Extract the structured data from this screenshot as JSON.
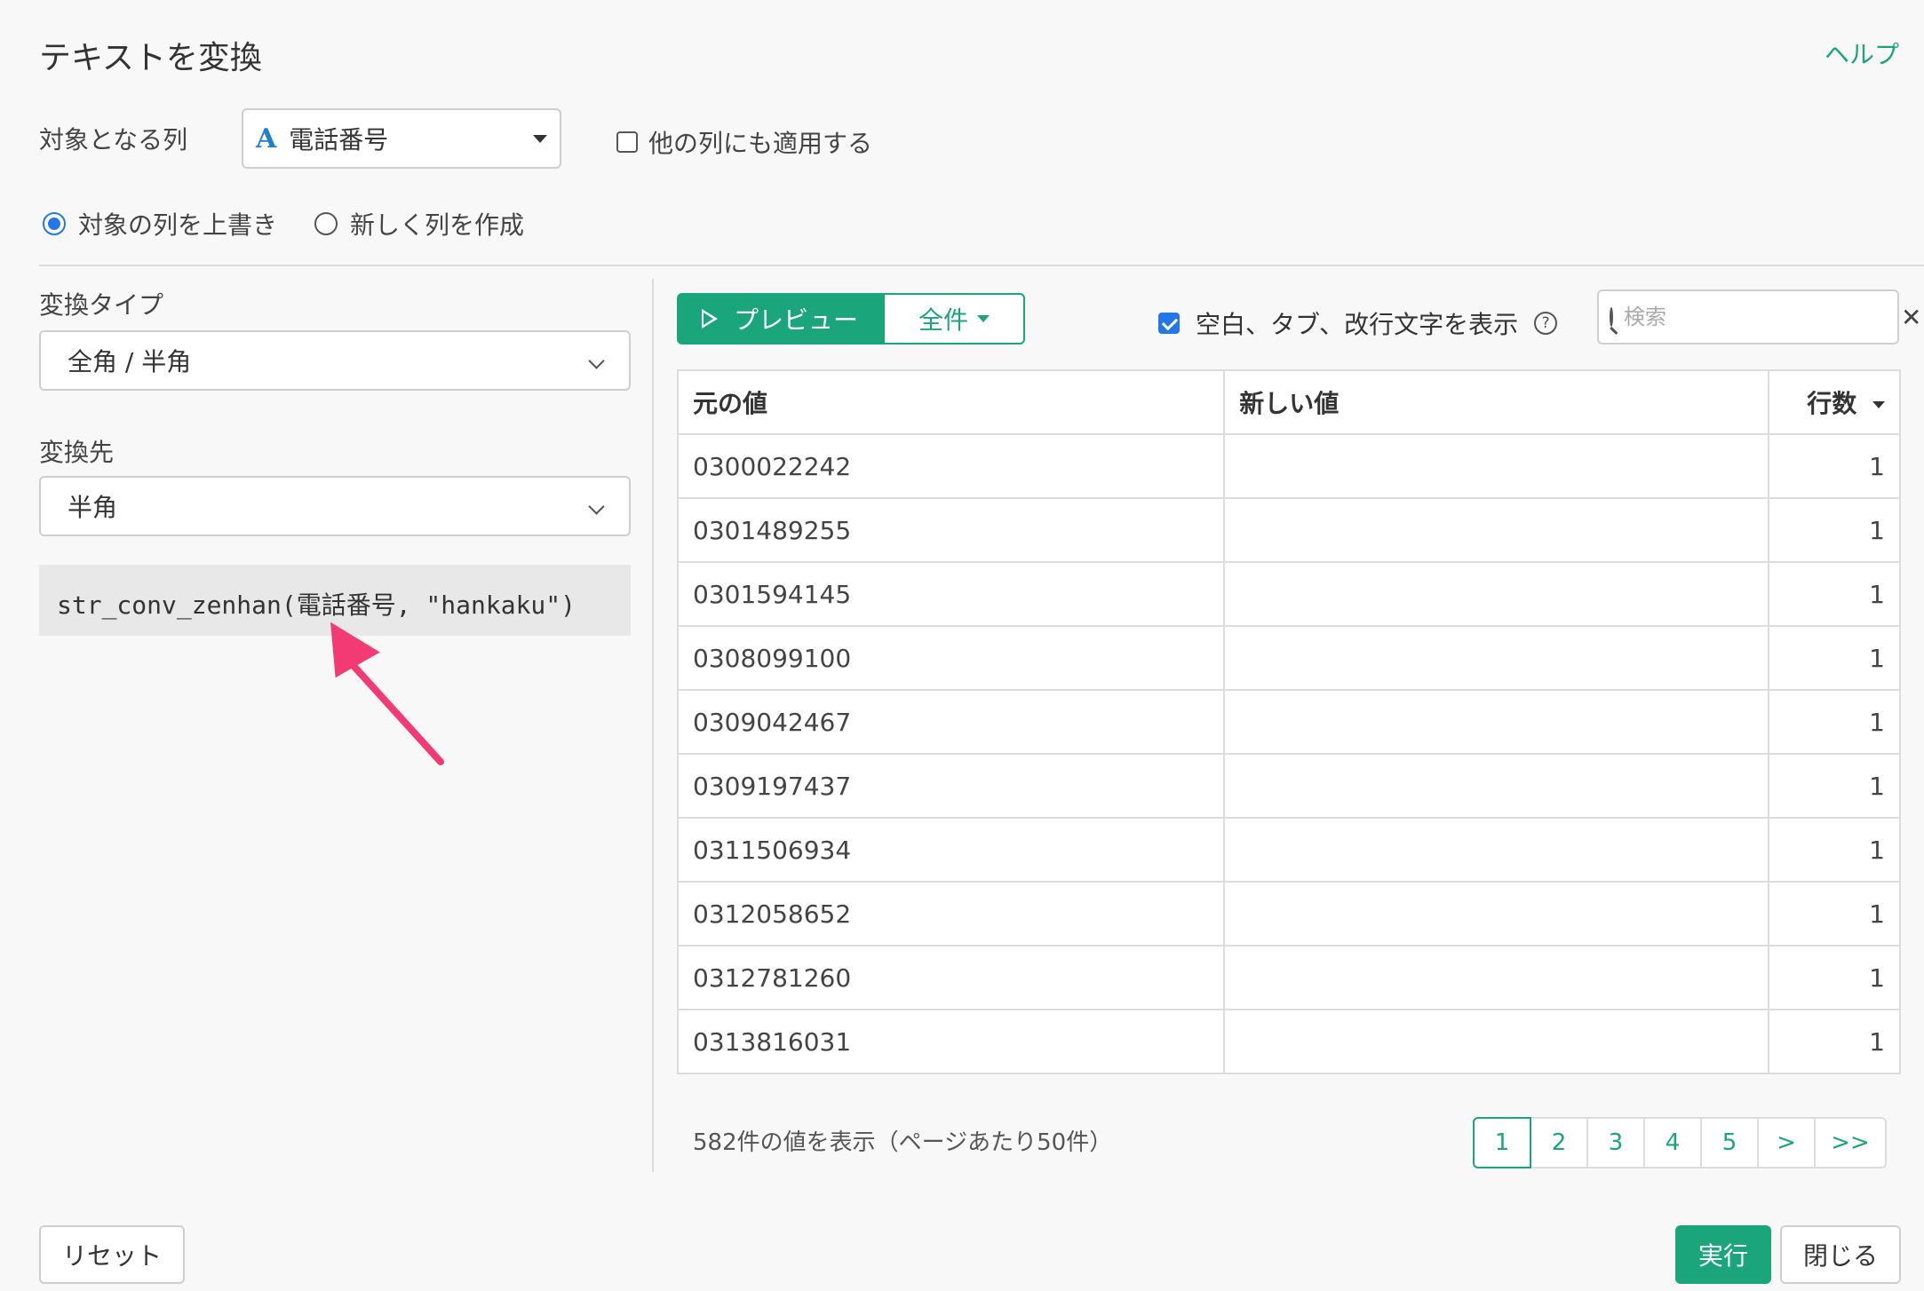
{
  "dialog": {
    "title": "テキストを変換",
    "help_label": "ヘルプ"
  },
  "target": {
    "label": "対象となる列",
    "column_type_icon": "A",
    "column_value": "電話番号",
    "apply_other_label": "他の列にも適用する",
    "apply_other_checked": false
  },
  "mode": {
    "overwrite_label": "対象の列を上書き",
    "new_column_label": "新しく列を作成",
    "selected": "overwrite"
  },
  "left": {
    "type_label": "変換タイプ",
    "type_value": "全角 / 半角",
    "dest_label": "変換先",
    "dest_value": "半角",
    "code": "str_conv_zenhan(電話番号, \"hankaku\")"
  },
  "toolbar": {
    "preview_label": "プレビュー",
    "all_label": "全件",
    "show_ws_label": "空白、タブ、改行文字を表示",
    "show_ws_checked": true,
    "help_glyph": "?",
    "search_placeholder": "検索",
    "clear_glyph": "✕"
  },
  "table": {
    "headers": [
      "元の値",
      "新しい値",
      "行数"
    ],
    "rows": [
      {
        "orig": "0300022242",
        "new": "",
        "count": "1"
      },
      {
        "orig": "0301489255",
        "new": "",
        "count": "1"
      },
      {
        "orig": "0301594145",
        "new": "",
        "count": "1"
      },
      {
        "orig": "0308099100",
        "new": "",
        "count": "1"
      },
      {
        "orig": "0309042467",
        "new": "",
        "count": "1"
      },
      {
        "orig": "0309197437",
        "new": "",
        "count": "1"
      },
      {
        "orig": "0311506934",
        "new": "",
        "count": "1"
      },
      {
        "orig": "0312058652",
        "new": "",
        "count": "1"
      },
      {
        "orig": "0312781260",
        "new": "",
        "count": "1"
      },
      {
        "orig": "0313816031",
        "new": "",
        "count": "1"
      }
    ]
  },
  "footer": {
    "summary": "582件の値を表示（ページあたり50件）",
    "pages": [
      "1",
      "2",
      "3",
      "4",
      "5",
      ">",
      ">>"
    ],
    "active_page": "1",
    "reset_label": "リセット",
    "run_label": "実行",
    "close_label": "閉じる"
  },
  "colors": {
    "accent": "#1aa57a",
    "checkbox_blue": "#2477e6",
    "annotation_arrow": "#f23a74"
  }
}
